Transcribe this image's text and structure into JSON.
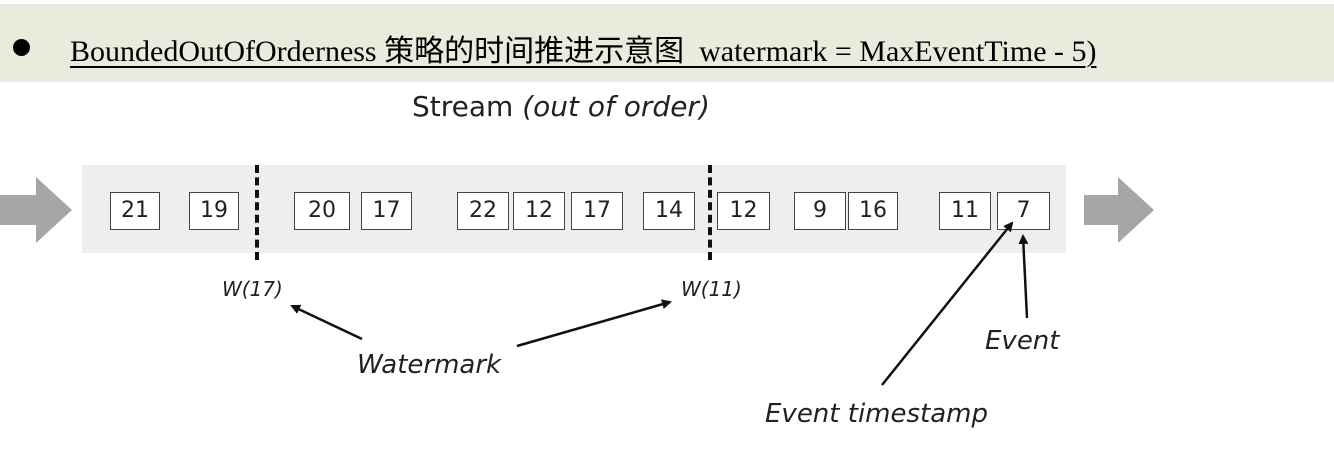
{
  "header": {
    "title": "BoundedOutOfOrderness 策略的时间推进示意图  watermark = MaxEventTime - 5)"
  },
  "diagram": {
    "stream_title": "Stream ",
    "stream_subtitle": "(out of order)",
    "events": [
      "21",
      "19",
      "20",
      "17",
      "22",
      "12",
      "17",
      "14",
      "12",
      "9",
      "16",
      "11",
      "7"
    ],
    "watermarks": [
      "W(17)",
      "W(11)"
    ],
    "labels": {
      "watermark": "Watermark",
      "event": "Event",
      "event_timestamp": "Event timestamp"
    },
    "icons": [
      "arrow-right-icon"
    ],
    "colors": {
      "header_background": "#e8ecdc",
      "stream_band": "#eeeeee",
      "flow_arrow": "#a6a6a6"
    }
  }
}
